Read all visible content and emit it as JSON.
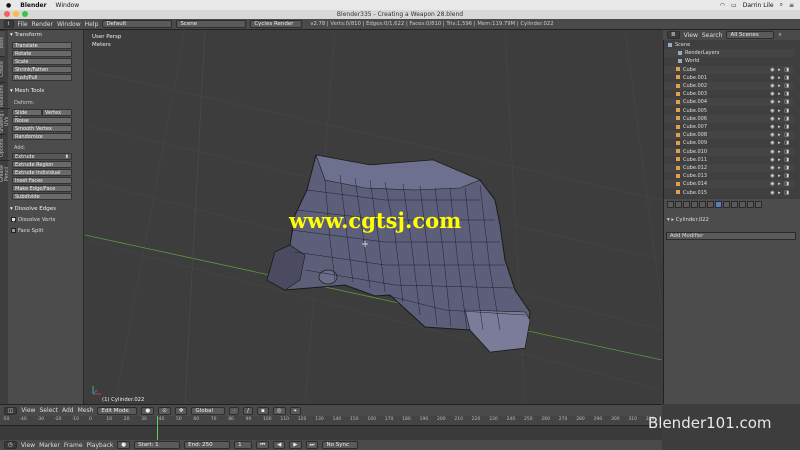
{
  "mac_menubar": {
    "app": "Blender",
    "menu": [
      "Window"
    ],
    "user": "Darrin Lile"
  },
  "window_title": "Blender335 - Creating a Weapon 28.blend",
  "info_header": {
    "menus": [
      "File",
      "Render",
      "Window",
      "Help"
    ],
    "layout": "Default",
    "scene": "Scene",
    "engine": "Cycles Render",
    "stats": "v2.78 | Verts:0/810 | Edges:0/1,622 | Faces:0/810 | Tris:1,596 | Mem:119.79M | Cylinder.022"
  },
  "tool_shelf": {
    "tabs": [
      "Tools",
      "Create",
      "Relations",
      "Shading / UVs",
      "Options",
      "Grease Pencil"
    ],
    "transform_title": "Transform",
    "transform_buttons": [
      "Translate",
      "Rotate",
      "Scale",
      "Shrink/Fatten",
      "Push/Pull"
    ],
    "mesh_tools_title": "Mesh Tools",
    "deform_label": "Deform:",
    "slide_edge": "Slide Edge",
    "vertex": "Vertex",
    "deform_buttons": [
      "Noise",
      "Smooth Vertex",
      "Randomize"
    ],
    "add_label": "Add:",
    "extrude": "Extrude",
    "add_buttons": [
      "Extrude Region",
      "Extrude Individual",
      "Inset Faces",
      "Make Edge/Face",
      "Subdivide"
    ],
    "op_title": "Dissolve Edges",
    "op_checkboxes": [
      "Dissolve Verts",
      "Face Split"
    ]
  },
  "viewport": {
    "view_label": "User Persp",
    "units_label": "Meters",
    "object_label": "(1) Cylinder.022"
  },
  "outliner": {
    "menus": [
      "View",
      "Search"
    ],
    "filter": "All Scenes",
    "scene_items": [
      "Scene",
      "RenderLayers",
      "World"
    ],
    "objects": [
      "Cube",
      "Cube.001",
      "Cube.002",
      "Cube.003",
      "Cube.004",
      "Cube.005",
      "Cube.006",
      "Cube.007",
      "Cube.008",
      "Cube.009",
      "Cube.010",
      "Cube.011",
      "Cube.012",
      "Cube.013",
      "Cube.014",
      "Cube.015"
    ]
  },
  "properties": {
    "object_name": "Cylinder.022",
    "add_modifier": "Add Modifier"
  },
  "view3d_header": {
    "menus": [
      "View",
      "Select",
      "Add",
      "Mesh"
    ],
    "mode": "Edit Mode",
    "orientation": "Global"
  },
  "timeline": {
    "ticks": [
      "-50",
      "-40",
      "-30",
      "-20",
      "-10",
      "0",
      "10",
      "20",
      "30",
      "40",
      "50",
      "60",
      "70",
      "80",
      "90",
      "100",
      "110",
      "120",
      "130",
      "140",
      "150",
      "160",
      "170",
      "180",
      "190",
      "200",
      "210",
      "220",
      "230",
      "240",
      "250",
      "260",
      "270",
      "280",
      "290",
      "300",
      "310",
      "320"
    ],
    "menus": [
      "View",
      "Marker",
      "Frame",
      "Playback"
    ],
    "start": "Start:",
    "start_val": "1",
    "end": "End:",
    "end_val": "250",
    "current": "1",
    "sync": "No Sync"
  },
  "watermarks": {
    "cgtsj": "www.cgtsj.com",
    "blender101": "Blender101.com"
  }
}
